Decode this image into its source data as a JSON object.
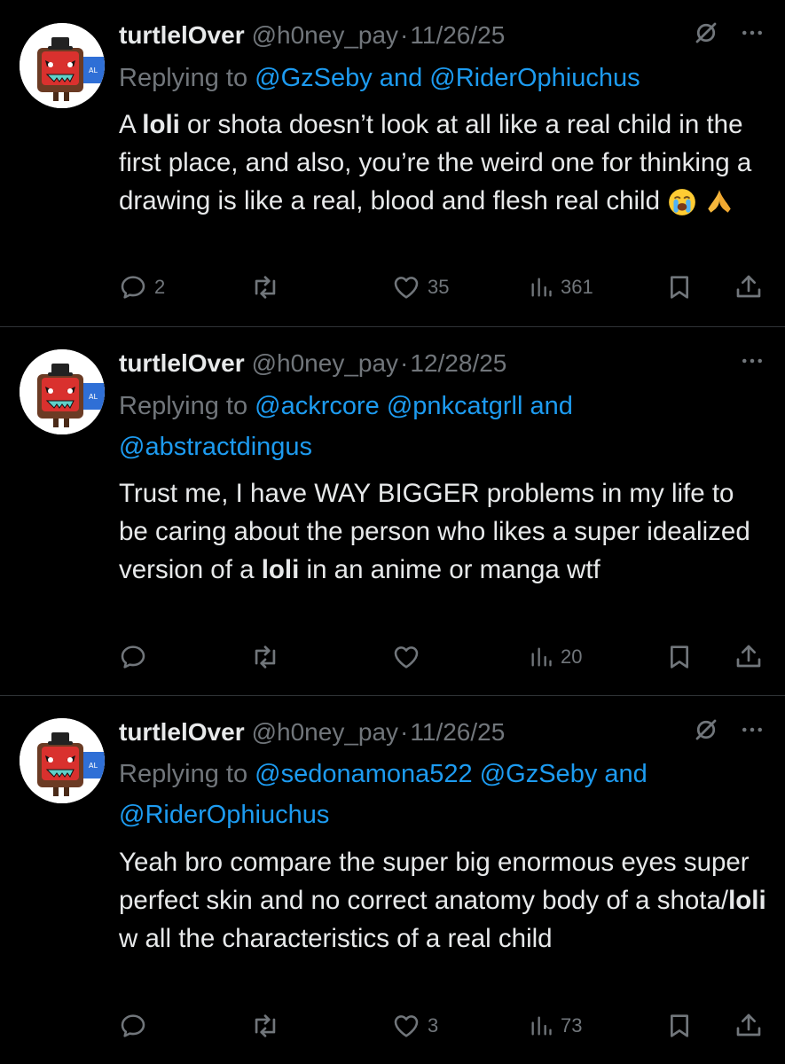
{
  "tweets": [
    {
      "name": "turtlelOver",
      "handle": "@h0ney_pay",
      "date": "11/26/25",
      "replying_prefix": "Replying to",
      "replying_links": "@GzSeby and @RiderOphiuchus",
      "text_a": "A ",
      "text_bold": "loli",
      "text_b": " or shota doesn’t look at all like a real child in the first place, and also, you’re the weird one for thinking a drawing is like a real, blood and flesh real child ",
      "emoji": [
        "crying-face",
        "folded-hands"
      ],
      "replies": "2",
      "likes": "35",
      "views": "361",
      "has_mute_icon": true
    },
    {
      "name": "turtlelOver",
      "handle": "@h0ney_pay",
      "date": "12/28/25",
      "replying_prefix": "Replying to",
      "replying_links": "@ackrcore @pnkcatgrll and @abstractdingus",
      "text_a": "Trust me, I have WAY BIGGER problems in my life to be caring about the person who likes a super idealized version of a ",
      "text_bold": "loli",
      "text_b": " in an anime or manga wtf",
      "replies": "",
      "likes": "",
      "views": "20",
      "has_mute_icon": false
    },
    {
      "name": "turtlelOver",
      "handle": "@h0ney_pay",
      "date": "11/26/25",
      "replying_prefix": "Replying to",
      "replying_links": "@sedonamona522 @GzSeby and @RiderOphiuchus",
      "text_a": "Yeah bro compare the super big enormous eyes super perfect skin and no correct anatomy body of a shota/",
      "text_bold": "loli",
      "text_b": " w all the characteristics of a real child",
      "replies": "",
      "likes": "3",
      "views": "73",
      "has_mute_icon": true
    }
  ],
  "colors": {
    "background": "#000000",
    "text": "#e7e9ea",
    "muted": "#71767b",
    "link": "#1d9bf0",
    "divider": "#2f3336"
  },
  "icons": [
    "reply-icon",
    "retweet-icon",
    "like-icon",
    "views-icon",
    "bookmark-icon",
    "share-icon",
    "mute-icon",
    "more-icon"
  ]
}
